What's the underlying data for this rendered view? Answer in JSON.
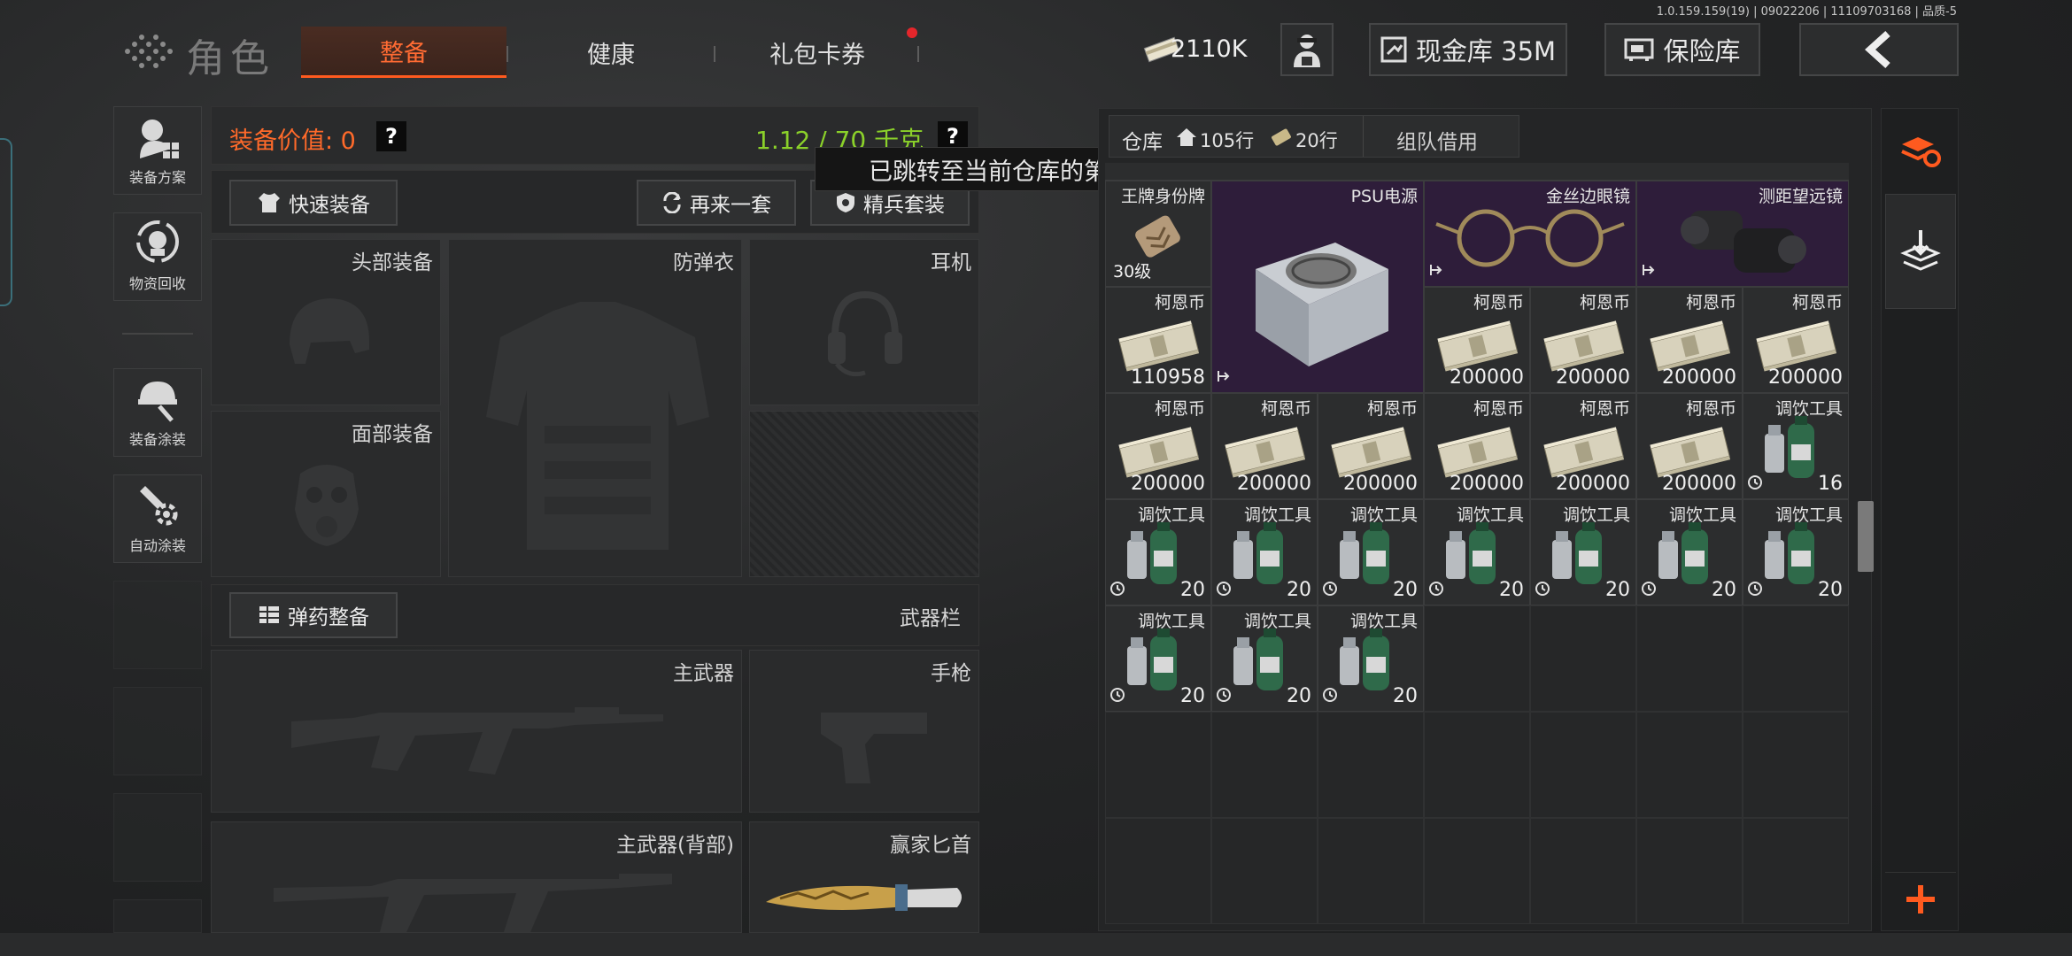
{
  "version_info": "1.0.159.159(19) | 09022206 | 11109703168 | 品质-5",
  "header": {
    "title": "角色",
    "tabs": [
      {
        "label": "整备",
        "active": true
      },
      {
        "label": "健康",
        "active": false
      },
      {
        "label": "礼包卡券",
        "active": false
      }
    ],
    "money": "2110K",
    "cash_vault": "现金库 35M",
    "insurance": "保险库"
  },
  "sidebar": {
    "items": [
      {
        "label": "装备方案",
        "icon": "soldier-loadout-icon"
      },
      {
        "label": "物资回收",
        "icon": "recycle-icon"
      },
      {
        "label": "装备涂装",
        "icon": "helmet-paint-icon"
      },
      {
        "label": "自动涂装",
        "icon": "auto-paint-icon"
      }
    ]
  },
  "loadout": {
    "value_label": "装备价值: 0",
    "weight": "1.12 / 70 千克",
    "quick_equip": "快速装备",
    "again": "再来一套",
    "elite_set": "精兵套装",
    "slots": {
      "head": "头部装备",
      "armor": "防弹衣",
      "headset": "耳机",
      "face": "面部装备",
      "primary": "主武器",
      "pistol": "手枪",
      "primary_back": "主武器(背部)",
      "knife": "赢家匕首"
    },
    "ammo_button": "弹药整备",
    "weapon_bar": "武器栏"
  },
  "tooltip": "已跳转至当前仓库的第一行空位",
  "stash": {
    "tab_label": "仓库",
    "rows_total": "105行",
    "rows_extra": "20行",
    "team_borrow": "组队借用",
    "items": [
      {
        "name": "王牌身份牌",
        "qty": "30级"
      },
      {
        "name": "PSU电源",
        "qty": ""
      },
      {
        "name": "金丝边眼镜",
        "qty": ""
      },
      {
        "name": "测距望远镜",
        "qty": ""
      },
      {
        "name": "柯恩币",
        "qty": "110958"
      },
      {
        "name": "柯恩币",
        "qty": "200000"
      },
      {
        "name": "柯恩币",
        "qty": "200000"
      },
      {
        "name": "柯恩币",
        "qty": "200000"
      },
      {
        "name": "柯恩币",
        "qty": "200000"
      },
      {
        "name": "柯恩币",
        "qty": "200000"
      },
      {
        "name": "柯恩币",
        "qty": "200000"
      },
      {
        "name": "柯恩币",
        "qty": "200000"
      },
      {
        "name": "柯恩币",
        "qty": "200000"
      },
      {
        "name": "柯恩币",
        "qty": "200000"
      },
      {
        "name": "调饮工具",
        "qty": "16"
      },
      {
        "name": "调饮工具",
        "qty": "20"
      },
      {
        "name": "调饮工具",
        "qty": "20"
      },
      {
        "name": "调饮工具",
        "qty": "20"
      },
      {
        "name": "调饮工具",
        "qty": "20"
      },
      {
        "name": "调饮工具",
        "qty": "20"
      },
      {
        "name": "调饮工具",
        "qty": "20"
      },
      {
        "name": "调饮工具",
        "qty": "20"
      },
      {
        "name": "调饮工具",
        "qty": "20"
      },
      {
        "name": "调饮工具",
        "qty": "20"
      },
      {
        "name": "调饮工具",
        "qty": "20"
      }
    ]
  },
  "colors": {
    "accent": "#ff5a1f",
    "weight_green": "#8bd12a",
    "purple_rarity": "#2e1d3a"
  }
}
